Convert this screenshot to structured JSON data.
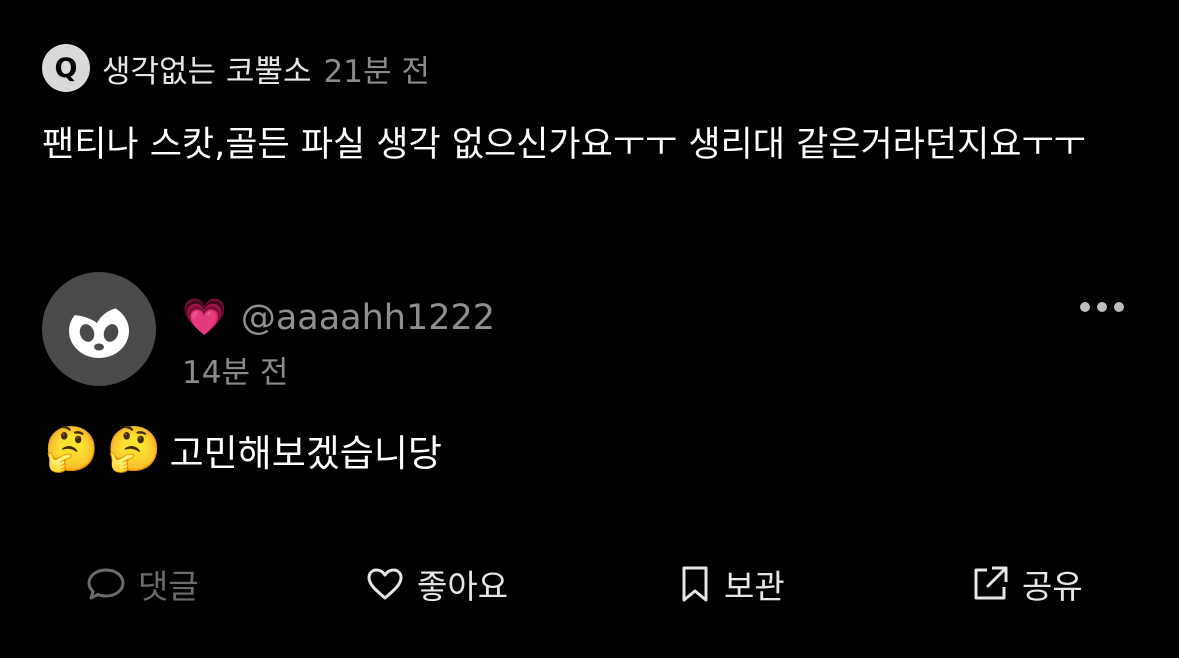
{
  "question": {
    "badge": "Q",
    "asker": "생각없는 코뿔소",
    "time": "21분 전",
    "text": "팬티나 스캇,골든 파실 생각 없으신가요ㅜㅜ 생리대 같은거라던지요ㅜㅜ"
  },
  "answer": {
    "avatar_icon": "panda-face-icon",
    "badge_emoji": "💗",
    "handle": "@aaaahh1222",
    "time": "14분 전",
    "emojis": [
      "🤔",
      "🤔"
    ],
    "text": "고민해보겠습니당",
    "more_icon": "more-dots-icon"
  },
  "actions": {
    "comment": {
      "label": "댓글",
      "icon": "speech-bubble-icon",
      "color": "#6b6b6b"
    },
    "like": {
      "label": "좋아요",
      "icon": "heart-outline-icon",
      "color": "#e6e6e6"
    },
    "save": {
      "label": "보관",
      "icon": "bookmark-icon",
      "color": "#e6e6e6"
    },
    "share": {
      "label": "공유",
      "icon": "share-external-icon",
      "color": "#e6e6e6"
    }
  },
  "colors": {
    "background": "#000000",
    "text_primary": "#ffffff",
    "text_secondary": "#8a8a8a",
    "avatar_bg": "#4a4a4a"
  }
}
